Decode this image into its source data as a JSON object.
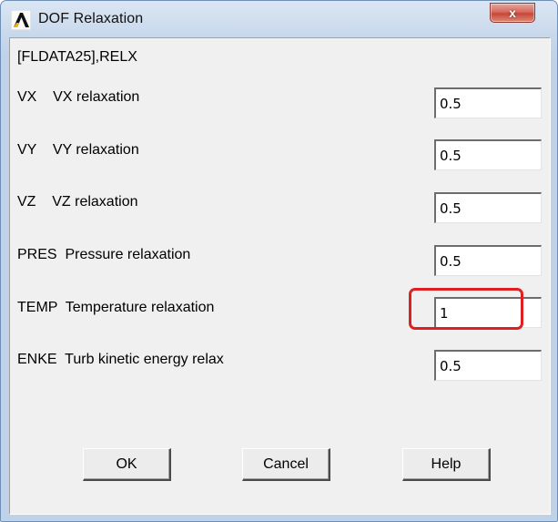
{
  "window": {
    "title": "DOF Relaxation",
    "close_label": "x",
    "app_icon": "ansys-logo-icon"
  },
  "command": "[FLDATA25],RELX",
  "rows": [
    {
      "label": "VX    VX relaxation",
      "value": "0.5"
    },
    {
      "label": "VY    VY relaxation",
      "value": "0.5"
    },
    {
      "label": "VZ    VZ relaxation",
      "value": "0.5"
    },
    {
      "label": "PRES  Pressure relaxation",
      "value": "0.5"
    },
    {
      "label": "TEMP  Temperature relaxation",
      "value": "1"
    },
    {
      "label": "ENKE  Turb kinetic energy relax",
      "value": "0.5"
    }
  ],
  "buttons": {
    "ok": "OK",
    "cancel": "Cancel",
    "help": "Help"
  },
  "colors": {
    "highlight": "#e02020",
    "close_button": "#c7473a"
  }
}
